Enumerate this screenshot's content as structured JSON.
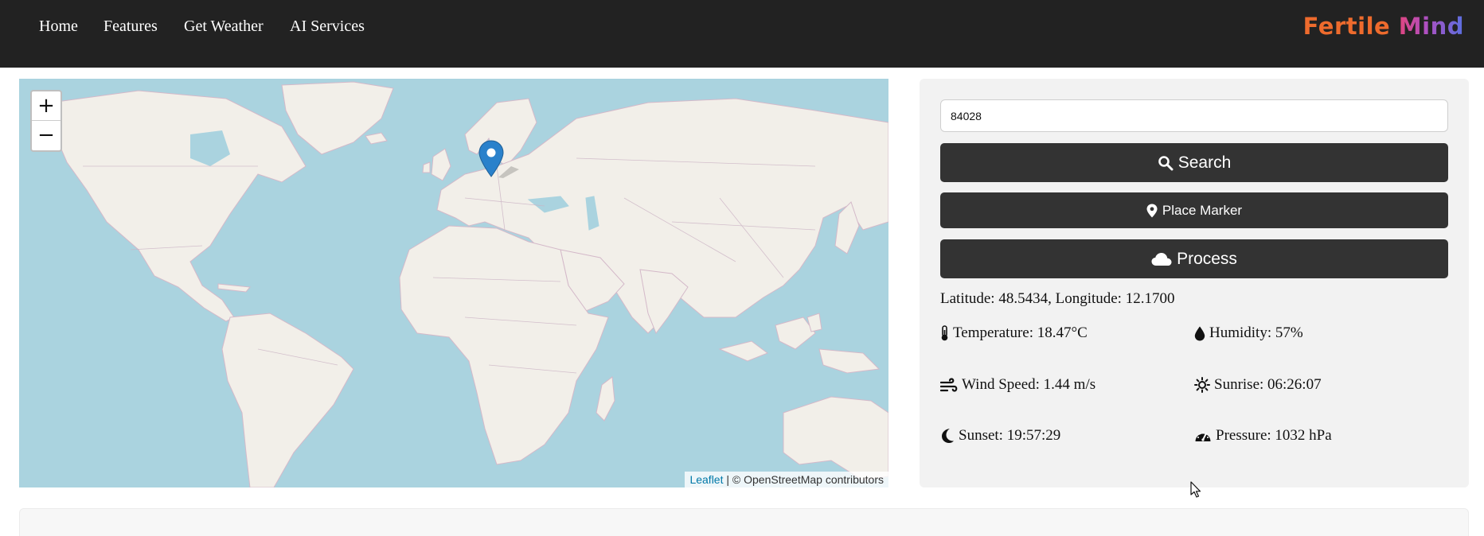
{
  "nav": {
    "links": [
      "Home",
      "Features",
      "Get Weather",
      "AI Services"
    ],
    "brand_part1": "Fertile",
    "brand_part2": "Mind"
  },
  "map": {
    "zoom_in": "+",
    "zoom_out": "−",
    "attribution_link": "Leaflet",
    "attribution_rest": " | © OpenStreetMap contributors",
    "marker_icon": "map-marker-icon"
  },
  "panel": {
    "search_value": "84028",
    "search_label": "Search",
    "place_marker_label": "Place Marker",
    "process_label": "Process",
    "coordinates": "Latitude: 48.5434, Longitude: 12.1700",
    "weather": {
      "temperature": "Temperature: 18.47°C",
      "humidity": "Humidity: 57%",
      "wind_speed": "Wind Speed: 1.44 m/s",
      "sunrise": "Sunrise: 06:26:07",
      "sunset": "Sunset: 19:57:29",
      "pressure": "Pressure: 1032 hPa"
    }
  },
  "colors": {
    "navbar": "#222222",
    "button": "#333333",
    "brand_orange": "#ee6b2d",
    "brand_gradient": [
      "#e0457f",
      "#5a6fe0"
    ],
    "marker": "#2a81cb",
    "water": "#aad3df",
    "land": "#f2efe9"
  }
}
